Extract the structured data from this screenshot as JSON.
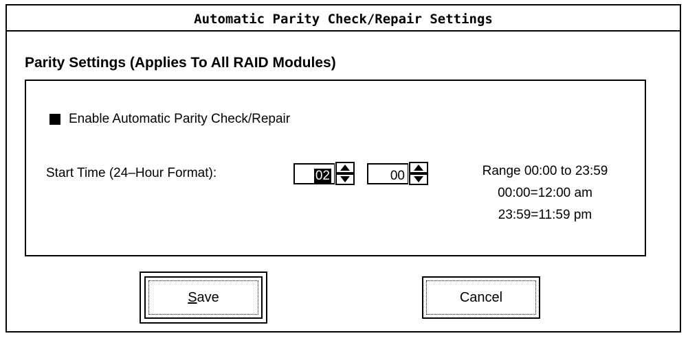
{
  "dialog": {
    "title": "Automatic Parity Check/Repair Settings",
    "section_title": "Parity Settings (Applies To All RAID Modules)",
    "enable_checkbox": {
      "label": "Enable Automatic Parity Check/Repair",
      "checked": true
    },
    "start_time": {
      "label": "Start Time (24–Hour Format):",
      "hour": "02",
      "minute": "00"
    },
    "range_info": [
      "Range 00:00 to 23:59",
      "00:00=12:00 am",
      "23:59=11:59 pm"
    ],
    "buttons": {
      "save_mnemonic": "S",
      "save_rest": "ave",
      "cancel": "Cancel"
    }
  }
}
